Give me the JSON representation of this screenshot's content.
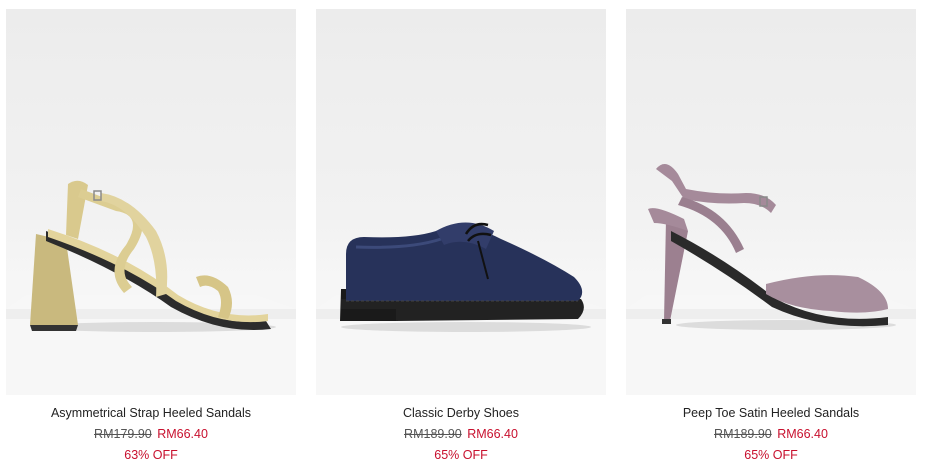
{
  "products": [
    {
      "name": "Asymmetrical Strap Heeled Sandals",
      "original_price": "RM179.90",
      "sale_price": "RM66.40",
      "discount": "63% OFF",
      "color": "#d9c98d"
    },
    {
      "name": "Classic Derby Shoes",
      "original_price": "RM189.90",
      "sale_price": "RM66.40",
      "discount": "65% OFF",
      "color": "#27325a"
    },
    {
      "name": "Peep Toe Satin Heeled Sandals",
      "original_price": "RM189.90",
      "sale_price": "RM66.40",
      "discount": "65% OFF",
      "color": "#a58a9a"
    }
  ],
  "sale_color": "#c8102e"
}
